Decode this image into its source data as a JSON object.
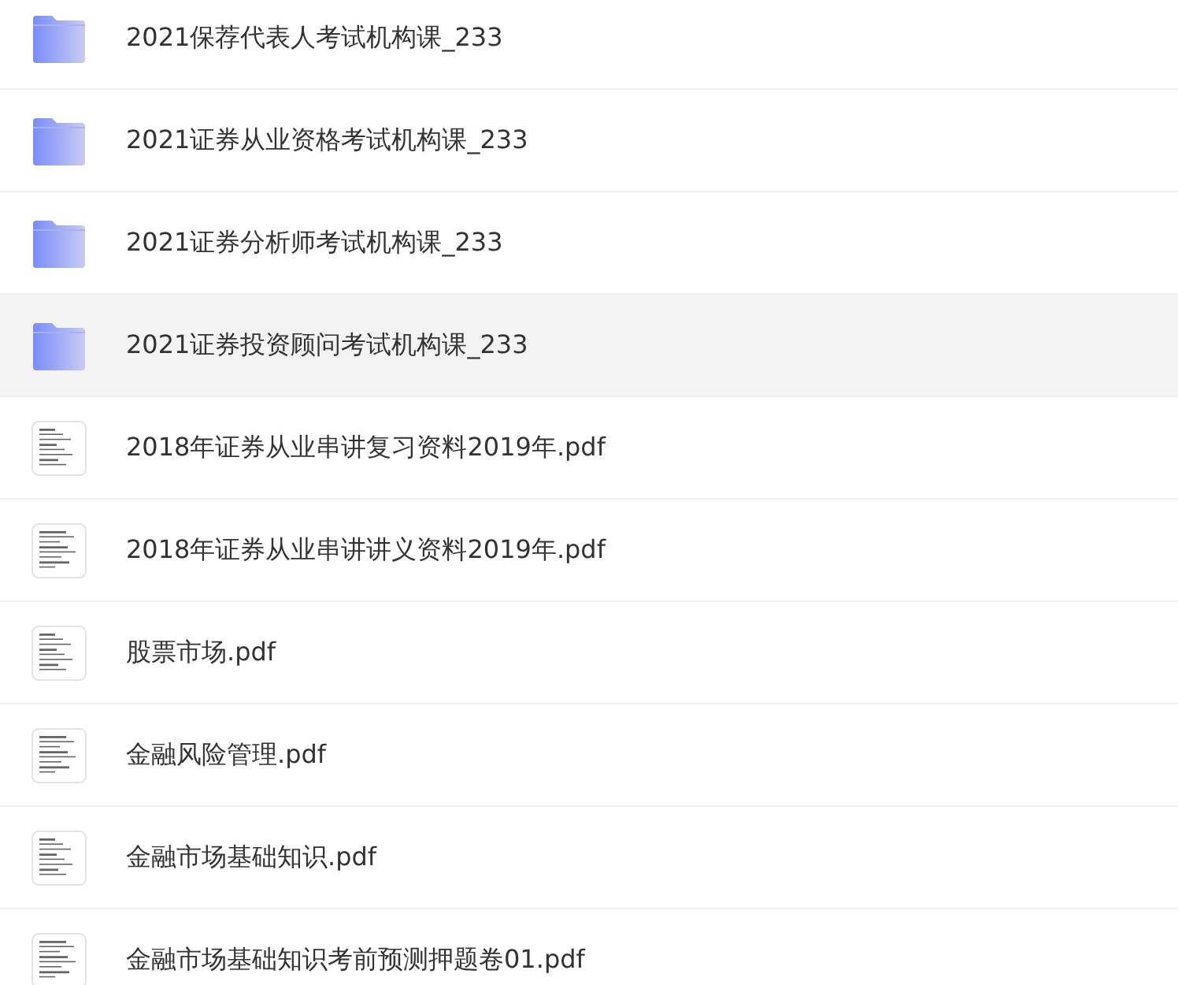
{
  "files": [
    {
      "kind": "folder",
      "name": "2021保荐代表人考试机构课_233",
      "selected": false
    },
    {
      "kind": "folder",
      "name": "2021证券从业资格考试机构课_233",
      "selected": false
    },
    {
      "kind": "folder",
      "name": "2021证券分析师考试机构课_233",
      "selected": false
    },
    {
      "kind": "folder",
      "name": "2021证券投资顾问考试机构课_233",
      "selected": true
    },
    {
      "kind": "pdf",
      "name": "2018年证券从业串讲复习资料2019年.pdf",
      "selected": false
    },
    {
      "kind": "pdf",
      "name": "2018年证券从业串讲讲义资料2019年.pdf",
      "selected": false
    },
    {
      "kind": "pdf",
      "name": "股票市场.pdf",
      "selected": false
    },
    {
      "kind": "pdf",
      "name": "金融风险管理.pdf",
      "selected": false
    },
    {
      "kind": "pdf",
      "name": "金融市场基础知识.pdf",
      "selected": false
    },
    {
      "kind": "pdf",
      "name": "金融市场基础知识考前预测押题卷01.pdf",
      "selected": false
    }
  ]
}
